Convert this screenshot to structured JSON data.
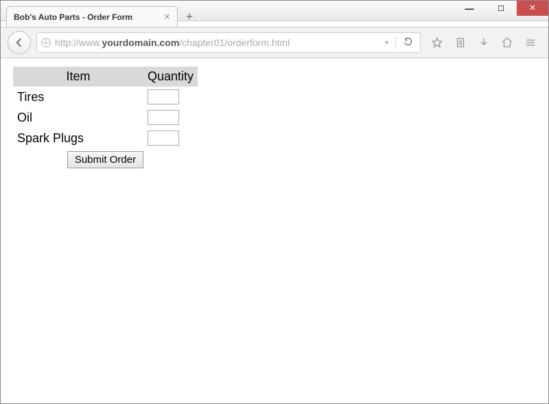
{
  "window": {
    "tab_title": "Bob's Auto Parts - Order Form",
    "url_pre": "http://www.",
    "url_domain": "yourdomain.com",
    "url_path": "/chapter01/orderform.html"
  },
  "toolbar": {
    "back": "←",
    "reload": "⟳",
    "dropdown": "▾",
    "star": "☆",
    "clipboard": "📋",
    "download": "↓",
    "home": "⌂",
    "menu": "≡"
  },
  "form": {
    "headers": {
      "item": "Item",
      "qty": "Quantity"
    },
    "rows": [
      {
        "label": "Tires",
        "value": ""
      },
      {
        "label": "Oil",
        "value": ""
      },
      {
        "label": "Spark Plugs",
        "value": ""
      }
    ],
    "submit": "Submit Order"
  },
  "win_controls": {
    "min": "—",
    "max": "☐",
    "close": "×"
  }
}
